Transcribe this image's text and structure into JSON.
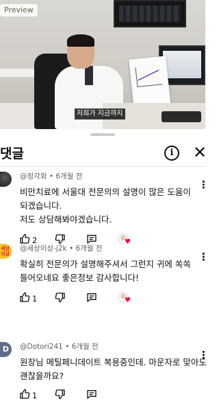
{
  "video": {
    "preview_badge": "Preview",
    "subtitle": "저희가 지금까지"
  },
  "comments_panel": {
    "title": "댓글",
    "info_glyph": "i",
    "close_glyph": "✕",
    "icons": [
      "info-icon",
      "close-icon",
      "thumb-up-icon",
      "thumb-down-icon",
      "reply-icon",
      "more-vert-icon",
      "heart-icon"
    ],
    "heart_color": "#ff0033",
    "comments": [
      {
        "author": "@정각화",
        "time": "6개월 전",
        "lines": [
          "비만치료에 서울대 전문의의 설명이 많은 도움이",
          "되겠습니다.",
          "저도 상담해봐야겠습니다."
        ],
        "likes": "2",
        "creator_hearted": true
      },
      {
        "author": "@세상이상-j2k",
        "time": "6개월 전",
        "avatar_text": "세상이상",
        "lines": [
          "확실히 전문의가 설명해주셔서 그런지 귀에 쏙쏙",
          "들어오네요 좋은정보 감사합니다!"
        ],
        "likes": "1",
        "creator_hearted": true
      },
      {
        "author": "@Dotori241",
        "time": "6개월 전",
        "avatar_letter": "D",
        "lines": [
          "원장님 메틸페니데이트 복용중인데. 마운자로 맞아도",
          "괜찮을까요?"
        ],
        "likes": "1",
        "creator_hearted": false
      }
    ]
  }
}
